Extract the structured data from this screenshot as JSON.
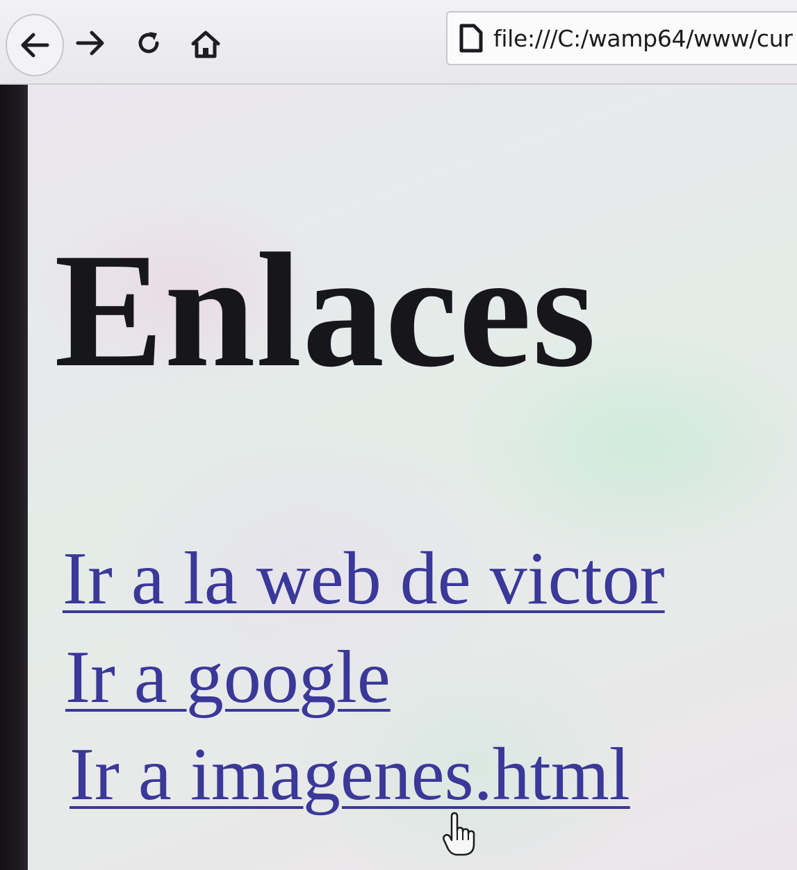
{
  "toolbar": {
    "back_icon": "arrow-left-icon",
    "forward_icon": "arrow-right-icon",
    "reload_icon": "reload-icon",
    "home_icon": "home-icon",
    "address_icon": "page-icon",
    "url": "file:///C:/wamp64/www/cur"
  },
  "page": {
    "title": "Enlaces",
    "links": [
      {
        "label": "Ir a la web de victor"
      },
      {
        "label": "Ir a google"
      },
      {
        "label": "Ir a imagenes.html"
      }
    ],
    "link_color": "#3a3898",
    "title_color": "#17161b",
    "pointer_icon": "hand-pointer-icon"
  }
}
